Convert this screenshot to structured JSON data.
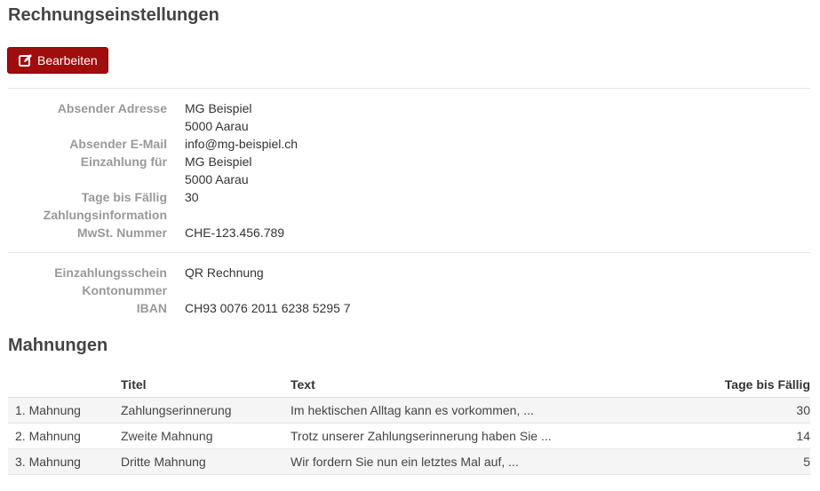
{
  "page": {
    "title": "Rechnungseinstellungen",
    "edit_label": "Bearbeiten"
  },
  "details": [
    {
      "label": "Absender Adresse",
      "value": "MG Beispiel"
    },
    {
      "label": "",
      "value": "5000 Aarau"
    },
    {
      "label": "Absender E-Mail",
      "value": "info@mg-beispiel.ch"
    },
    {
      "label": "Einzahlung für",
      "value": "MG Beispiel"
    },
    {
      "label": "",
      "value": "5000 Aarau"
    },
    {
      "label": "Tage bis Fällig",
      "value": "30"
    },
    {
      "label": "Zahlungsinformation",
      "value": ""
    },
    {
      "label": "MwSt. Nummer",
      "value": "CHE-123.456.789"
    }
  ],
  "payment": [
    {
      "label": "Einzahlungsschein",
      "value": "QR Rechnung"
    },
    {
      "label": "Kontonummer",
      "value": ""
    },
    {
      "label": "IBAN",
      "value": "CH93 0076 2011 6238 5295 7"
    }
  ],
  "reminders": {
    "title": "Mahnungen",
    "columns": [
      "",
      "Titel",
      "Text",
      "Tage bis Fällig"
    ],
    "rows": [
      {
        "name": "1. Mahnung",
        "title": "Zahlungserinnerung",
        "text": "Im hektischen Alltag kann es vorkommen, ...",
        "days": "30"
      },
      {
        "name": "2. Mahnung",
        "title": "Zweite Mahnung",
        "text": "Trotz unserer Zahlungserinnerung haben Sie ...",
        "days": "14"
      },
      {
        "name": "3. Mahnung",
        "title": "Dritte Mahnung",
        "text": "Wir fordern Sie nun ein letztes Mal auf, ...",
        "days": "5"
      }
    ]
  },
  "colors": {
    "accent": "#a00d0d",
    "label": "#999999",
    "stripe": "#f5f5f5"
  }
}
